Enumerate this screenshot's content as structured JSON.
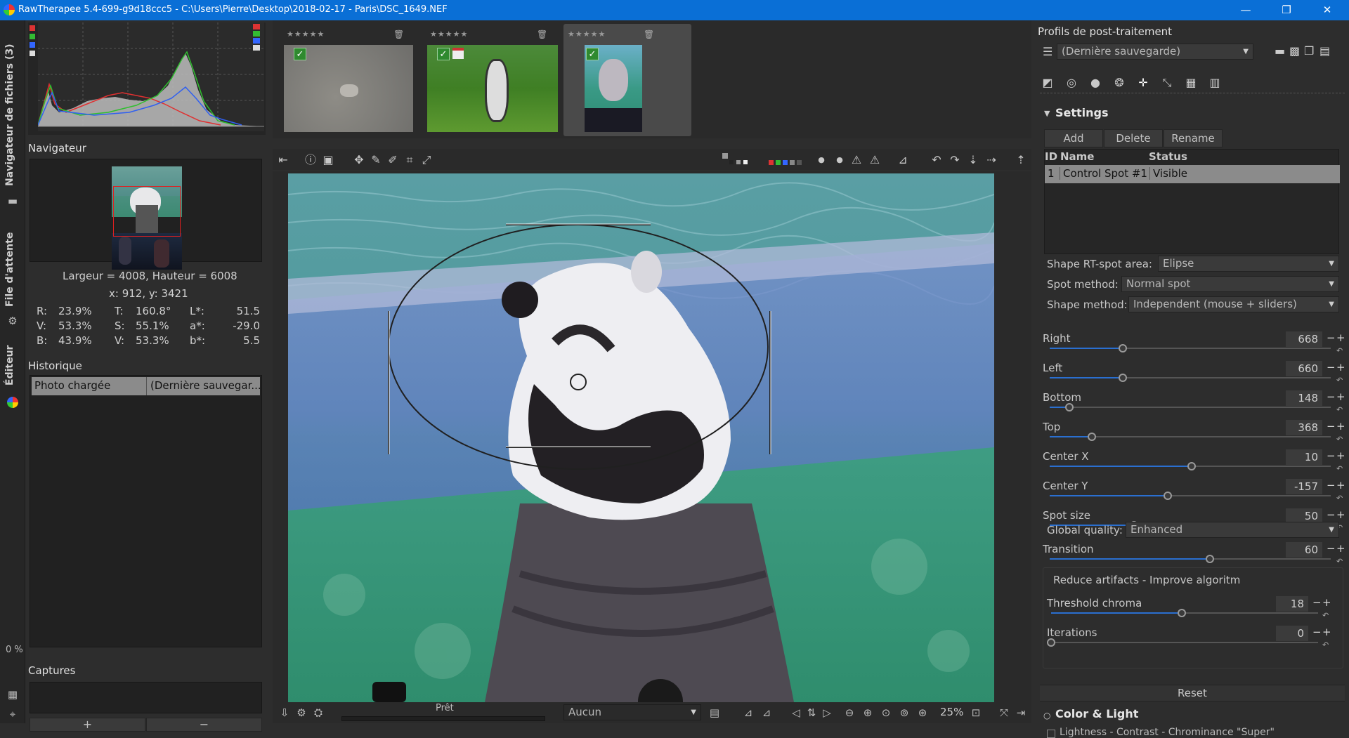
{
  "window": {
    "title": "RawTherapee 5.4-699-g9d18ccc5 - C:\\Users\\Pierre\\Desktop\\2018-02-17 - Paris\\DSC_1649.NEF",
    "minimize": "—",
    "restore": "❐",
    "close": "✕"
  },
  "vtabs": {
    "file_browser": "Navigateur de fichiers (3)",
    "queue": "File d'attente",
    "editor": "Éditeur"
  },
  "navigator": {
    "title": "Navigateur",
    "dimensions": "Largeur = 4008, Hauteur = 6008",
    "coords": "x: 912, y: 3421",
    "r_label": "R:",
    "r_val": "23.9%",
    "v_label": "V:",
    "v_val": "53.3%",
    "b_label": "B:",
    "b_val": "43.9%",
    "t_label": "T:",
    "t_val": "160.8°",
    "s_label": "S:",
    "s_val": "55.1%",
    "v2_label": "V:",
    "v2_val": "53.3%",
    "l_label": "L*:",
    "l_val": "51.5",
    "a_label": "a*:",
    "a_val": "-29.0",
    "bs_label": "b*:",
    "bs_val": "5.5"
  },
  "history": {
    "title": "Historique",
    "rows": [
      {
        "action": "Photo chargée",
        "value": "(Dernière sauvegar..."
      }
    ]
  },
  "snapshots": {
    "title": "Captures",
    "add": "+",
    "remove": "−",
    "percent": "0 %"
  },
  "filmstrip": {
    "stars": "★★★★★",
    "thumbs": [
      {
        "name": "squirrel",
        "checked": true,
        "selected": false
      },
      {
        "name": "lemur",
        "checked": true,
        "selected": false
      },
      {
        "name": "hippo",
        "checked": true,
        "selected": true
      }
    ]
  },
  "statusbar": {
    "status": "Prêt",
    "preset_select": "Aucun",
    "zoom": "25%"
  },
  "right": {
    "profiles_title": "Profils de post-traitement",
    "profile_select": "(Dernière sauvegarde)",
    "settings_title": "Settings",
    "add": "Add",
    "delete": "Delete",
    "rename": "Rename",
    "col_id": "ID",
    "col_name": "Name",
    "col_status": "Status",
    "spots": [
      {
        "id": "1",
        "name": "Control Spot #1",
        "status": "Visible"
      }
    ],
    "shape_label": "Shape RT-spot area:",
    "shape_value": "Elipse",
    "spot_method_label": "Spot method:",
    "spot_method_value": "Normal spot",
    "shape_method_label": "Shape method:",
    "shape_method_value": "Independent (mouse + sliders)",
    "sliders": [
      {
        "label": "Right",
        "value": "668",
        "fraction": 0.26
      },
      {
        "label": "Left",
        "value": "660",
        "fraction": 0.26
      },
      {
        "label": "Bottom",
        "value": "148",
        "fraction": 0.07
      },
      {
        "label": "Top",
        "value": "368",
        "fraction": 0.15
      },
      {
        "label": "Center X",
        "value": "10",
        "fraction": 0.505
      },
      {
        "label": "Center Y",
        "value": "-157",
        "fraction": 0.42
      },
      {
        "label": "Spot size",
        "value": "50",
        "fraction": 0.3
      }
    ],
    "quality_label": "Global quality:",
    "quality_value": "Enhanced",
    "transition_label": "Transition",
    "transition_value": "60",
    "transition_fraction": 0.57,
    "artifacts_title": "Reduce artifacts - Improve algoritm",
    "threshold_label": "Threshold chroma",
    "threshold_value": "18",
    "threshold_fraction": 0.49,
    "iterations_label": "Iterations",
    "iterations_value": "0",
    "iterations_fraction": 0.0,
    "reset": "Reset",
    "color_light_title": "Color & Light",
    "next_item": "Lightness - Contrast - Chrominance \"Super\""
  },
  "colors": {
    "accent": "#0a6fd6",
    "slider_fill": "#2a6fd0",
    "panel": "#2d2d2d"
  }
}
